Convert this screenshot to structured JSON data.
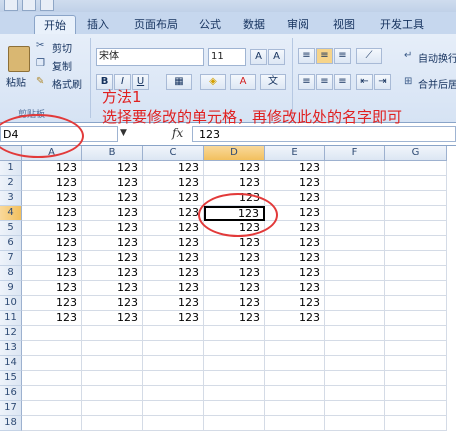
{
  "tabs": [
    {
      "label": "开始",
      "active": true
    },
    {
      "label": "插入",
      "active": false
    },
    {
      "label": "页面布局",
      "active": false
    },
    {
      "label": "公式",
      "active": false
    },
    {
      "label": "数据",
      "active": false
    },
    {
      "label": "审阅",
      "active": false
    },
    {
      "label": "视图",
      "active": false
    },
    {
      "label": "开发工具",
      "active": false
    }
  ],
  "ribbon": {
    "paste_label": "粘贴",
    "cut_label": "剪切",
    "copy_label": "复制",
    "format_painter_label": "格式刷",
    "clipboard_group_label": "剪贴板",
    "font_name": "宋体",
    "font_size": "11",
    "wrap_text_label": "自动换行",
    "merge_label": "合并后居"
  },
  "formula_bar": {
    "name_box": "D4",
    "fx": "fx",
    "formula": "123"
  },
  "annotation": {
    "title": "方法1",
    "text": "选择要修改的单元格，再修改此处的名字即可"
  },
  "columns": [
    "A",
    "B",
    "C",
    "D",
    "E",
    "F",
    "G"
  ],
  "selected_column": "D",
  "rows": [
    "1",
    "2",
    "3",
    "4",
    "5",
    "6",
    "7",
    "8",
    "9",
    "10",
    "11",
    "12",
    "13",
    "14",
    "15",
    "16",
    "17",
    "18"
  ],
  "selected_row": "4",
  "cells": [
    [
      "123",
      "123",
      "123",
      "123",
      "123",
      "",
      ""
    ],
    [
      "123",
      "123",
      "123",
      "123",
      "123",
      "",
      ""
    ],
    [
      "123",
      "123",
      "123",
      "123",
      "123",
      "",
      ""
    ],
    [
      "123",
      "123",
      "123",
      "123",
      "123",
      "",
      ""
    ],
    [
      "123",
      "123",
      "123",
      "123",
      "123",
      "",
      ""
    ],
    [
      "123",
      "123",
      "123",
      "123",
      "123",
      "",
      ""
    ],
    [
      "123",
      "123",
      "123",
      "123",
      "123",
      "",
      ""
    ],
    [
      "123",
      "123",
      "123",
      "123",
      "123",
      "",
      ""
    ],
    [
      "123",
      "123",
      "123",
      "123",
      "123",
      "",
      ""
    ],
    [
      "123",
      "123",
      "123",
      "123",
      "123",
      "",
      ""
    ],
    [
      "123",
      "123",
      "123",
      "123",
      "123",
      "",
      ""
    ],
    [
      "",
      "",
      "",
      "",
      "",
      "",
      ""
    ],
    [
      "",
      "",
      "",
      "",
      "",
      "",
      ""
    ],
    [
      "",
      "",
      "",
      "",
      "",
      "",
      ""
    ],
    [
      "",
      "",
      "",
      "",
      "",
      "",
      ""
    ],
    [
      "",
      "",
      "",
      "",
      "",
      "",
      ""
    ],
    [
      "",
      "",
      "",
      "",
      "",
      "",
      ""
    ],
    [
      "",
      "",
      "",
      "",
      "",
      "",
      ""
    ]
  ],
  "colors": {
    "annotation": "#e02020",
    "selection": "#f2c05e"
  }
}
